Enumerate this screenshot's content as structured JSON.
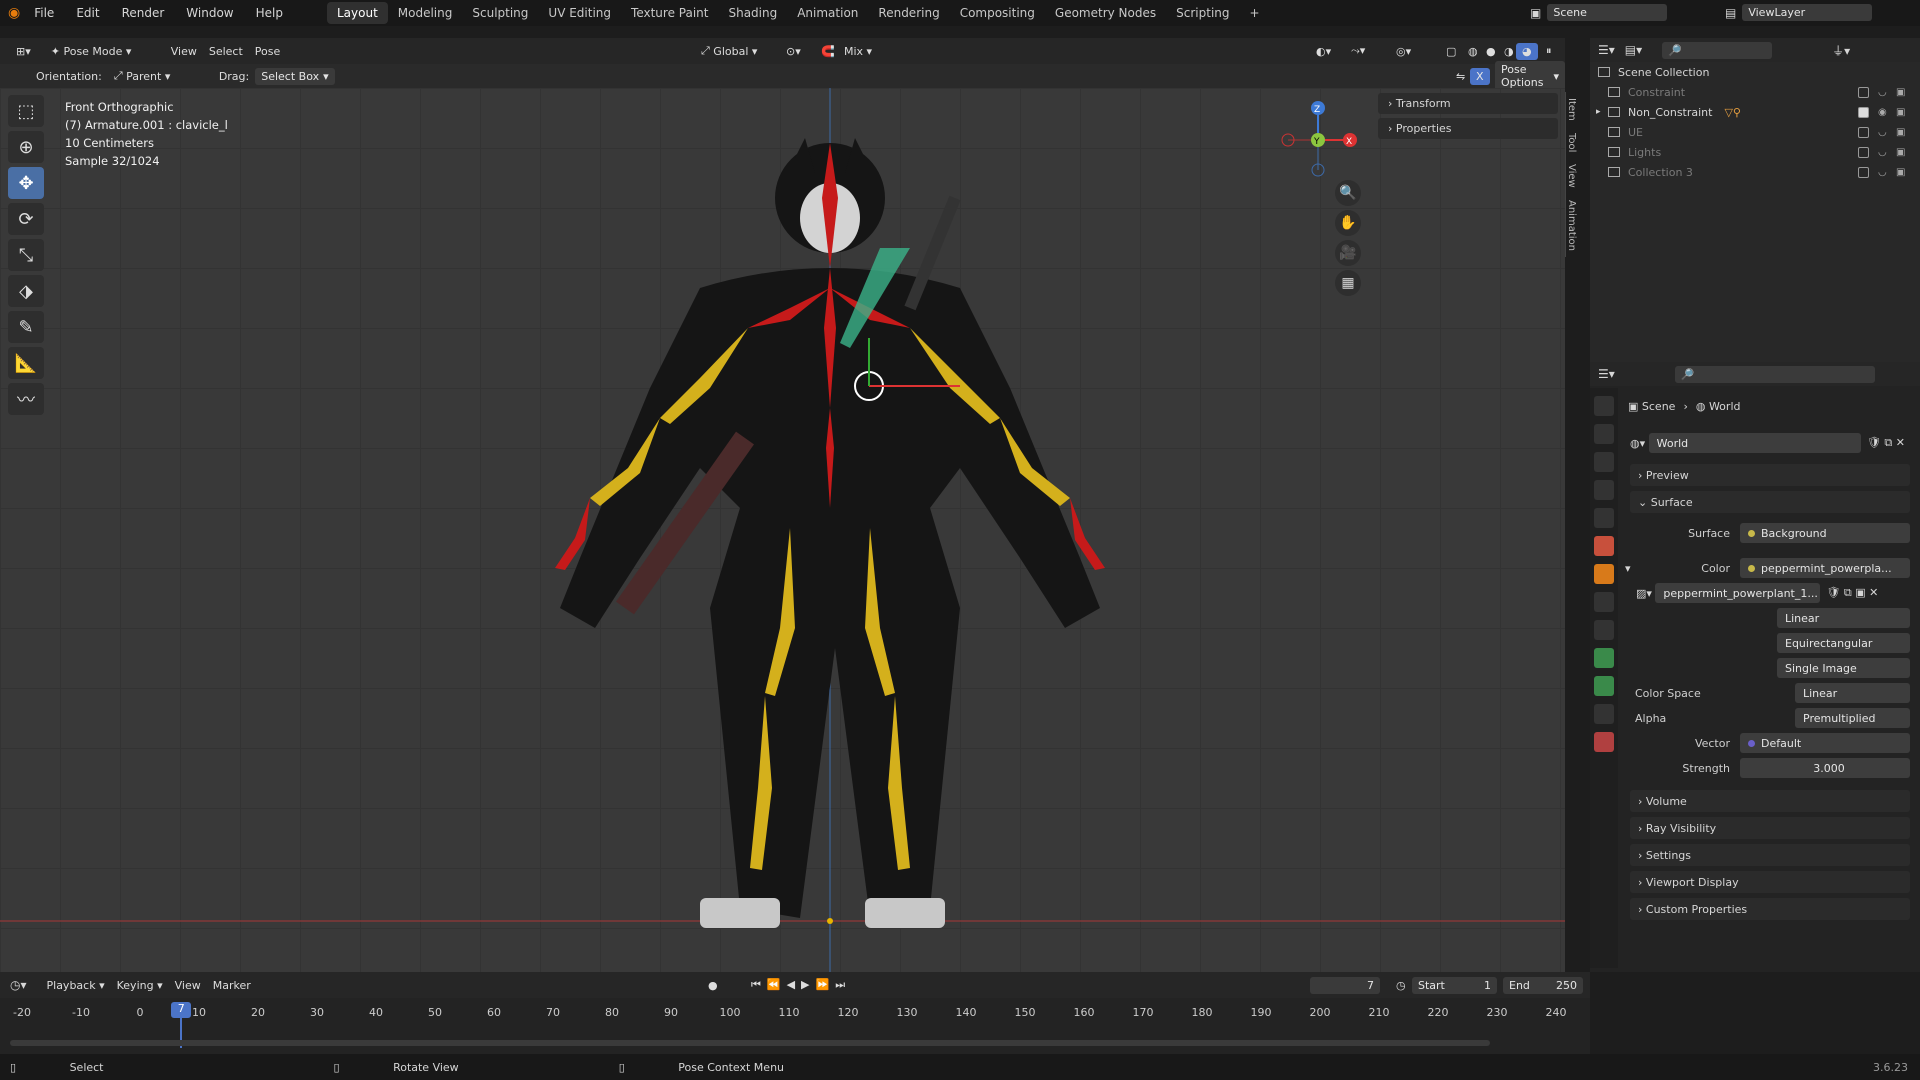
{
  "topbar": {
    "menus": [
      "File",
      "Edit",
      "Render",
      "Window",
      "Help"
    ],
    "workspaces": [
      "Layout",
      "Modeling",
      "Sculpting",
      "UV Editing",
      "Texture Paint",
      "Shading",
      "Animation",
      "Rendering",
      "Compositing",
      "Geometry Nodes",
      "Scripting"
    ],
    "active_workspace": "Layout",
    "add_tab": "+",
    "scene_label": "Scene",
    "view_layer_label": "ViewLayer"
  },
  "viewport_header": {
    "mode": "Pose Mode",
    "menus": [
      "View",
      "Select",
      "Pose"
    ],
    "transform_orientation": "Global",
    "snap_mode": "Mix"
  },
  "tool_header": {
    "orientation_label": "Orientation:",
    "orientation_value": "Parent",
    "drag_label": "Drag:",
    "drag_value": "Select Box",
    "x_mirror": "X",
    "pose_options": "Pose Options"
  },
  "viewport_info": {
    "view": "Front Orthographic",
    "object": "(7) Armature.001 : clavicle_l",
    "scale": "10 Centimeters",
    "sample": "Sample 32/1024"
  },
  "npanel": {
    "sections": [
      "Transform",
      "Properties"
    ],
    "tabs": [
      "Item",
      "Tool",
      "View",
      "Animation"
    ]
  },
  "gizmo": {
    "z": "Z",
    "y": "Y",
    "x": "X"
  },
  "outliner": {
    "root": "Scene Collection",
    "items": [
      {
        "label": "Constraint",
        "enabled": false
      },
      {
        "label": "Non_Constraint",
        "enabled": true
      },
      {
        "label": "UE",
        "enabled": false
      },
      {
        "label": "Lights",
        "enabled": false
      },
      {
        "label": "Collection 3",
        "enabled": false
      }
    ]
  },
  "properties": {
    "breadcrumb_scene": "Scene",
    "breadcrumb_world": "World",
    "world_name": "World",
    "sections": {
      "preview": "Preview",
      "surface": "Surface",
      "volume": "Volume",
      "ray_visibility": "Ray Visibility",
      "settings": "Settings",
      "viewport_display": "Viewport Display",
      "custom_properties": "Custom Properties"
    },
    "surface_label": "Surface",
    "surface_value": "Background",
    "color_label": "Color",
    "color_value": "peppermint_powerpla...",
    "image_name": "peppermint_powerplant_1...",
    "interpolation": "Linear",
    "projection": "Equirectangular",
    "source": "Single Image",
    "color_space_label": "Color Space",
    "color_space_value": "Linear",
    "alpha_label": "Alpha",
    "alpha_value": "Premultiplied",
    "vector_label": "Vector",
    "vector_value": "Default",
    "strength_label": "Strength",
    "strength_value": "3.000"
  },
  "timeline": {
    "menus": [
      "Playback",
      "Keying",
      "View",
      "Marker"
    ],
    "current_frame": "7",
    "start_label": "Start",
    "start_value": "1",
    "end_label": "End",
    "end_value": "250",
    "ticks": [
      "-20",
      "-10",
      "0",
      "10",
      "20",
      "30",
      "40",
      "50",
      "60",
      "70",
      "80",
      "90",
      "100",
      "110",
      "120",
      "130",
      "140",
      "150",
      "160",
      "170",
      "180",
      "190",
      "200",
      "210",
      "220",
      "230",
      "240"
    ],
    "playhead": "7"
  },
  "statusbar": {
    "items": [
      "Select",
      "Rotate View",
      "Pose Context Menu"
    ],
    "version": "3.6.23"
  },
  "colors": {
    "accent": "#4b74c8",
    "bone_selected": "#d4b01c",
    "bone_red": "#c61a1a"
  }
}
